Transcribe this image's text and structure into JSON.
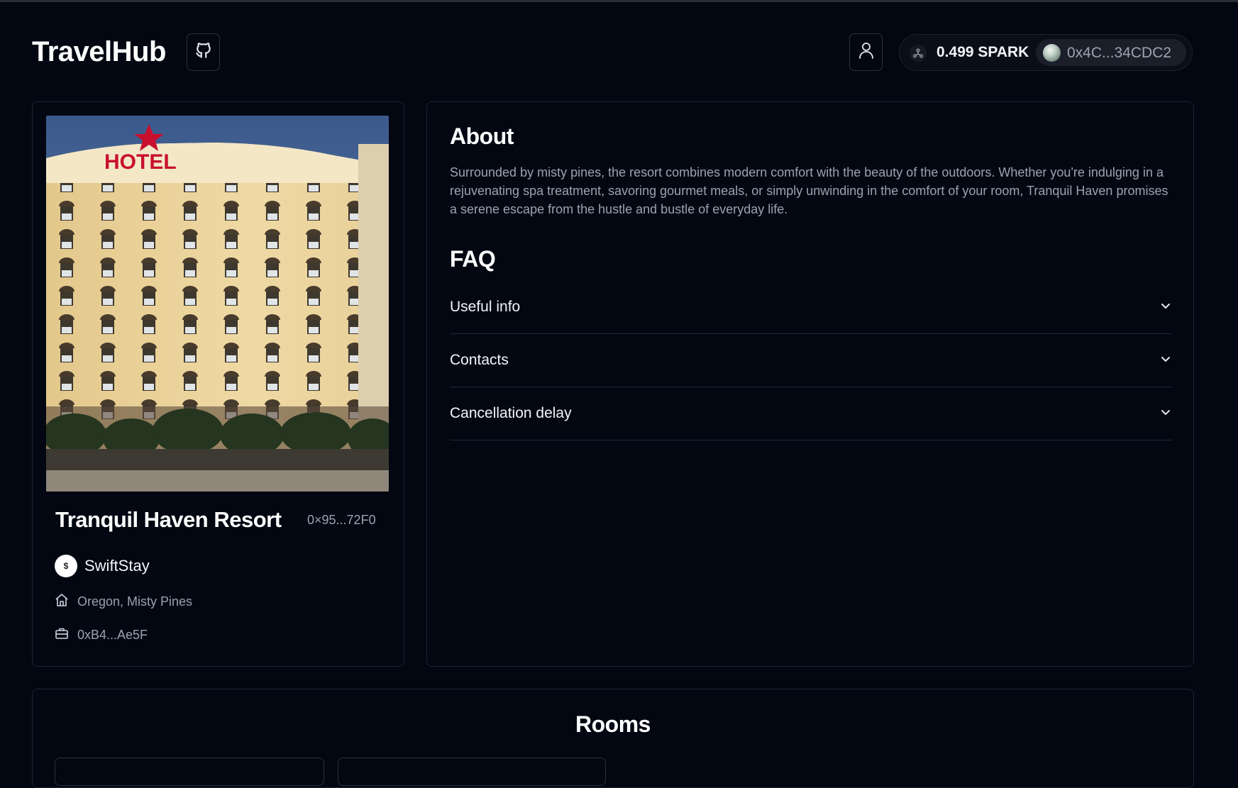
{
  "header": {
    "brand": "TravelHub",
    "github_icon": "github-icon",
    "user_icon": "user-icon",
    "spark_icon": "network-icon",
    "balance": "0.499 SPARK",
    "wallet_address": "0x4C...34CDC2"
  },
  "hotel": {
    "name": "Tranquil Haven Resort",
    "address": "0×95...72F0",
    "brand_name": "SwiftStay",
    "location": "Oregon, Misty Pines",
    "owner": "0xB4...Ae5F",
    "image_sign": "HOTEL"
  },
  "about": {
    "title": "About",
    "text": "Surrounded by misty pines, the resort combines modern comfort with the beauty of the outdoors. Whether you're indulging in a rejuvenating spa treatment, savoring gourmet meals, or simply unwinding in the comfort of your room, Tranquil Haven promises a serene escape from the hustle and bustle of everyday life."
  },
  "faq": {
    "title": "FAQ",
    "items": [
      {
        "label": "Useful info"
      },
      {
        "label": "Contacts"
      },
      {
        "label": "Cancellation delay"
      }
    ]
  },
  "rooms": {
    "title": "Rooms"
  },
  "colors": {
    "background": "#030712",
    "border": "#1e2330",
    "muted_text": "#9aa3af"
  }
}
